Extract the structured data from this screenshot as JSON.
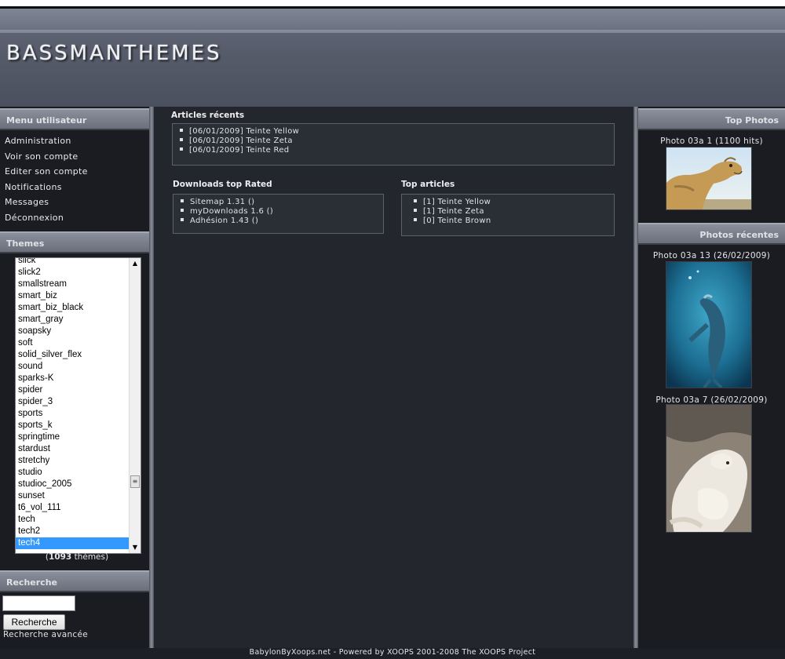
{
  "site": {
    "logo_text": "BASSMANTHEMES"
  },
  "left": {
    "user_menu_title": "Menu utilisateur",
    "user_menu": [
      "Administration",
      "Voir son compte",
      "Editer son compte",
      "Notifications",
      "Messages",
      "Déconnexion"
    ],
    "themes_title": "Themes",
    "themes": [
      "slick",
      "slick2",
      "smallstream",
      "smart_biz",
      "smart_biz_black",
      "smart_gray",
      "soapsky",
      "soft",
      "solid_silver_flex",
      "sound",
      "sparks-K",
      "spider",
      "spider_3",
      "sports",
      "sports_k",
      "springtime",
      "stardust",
      "stretchy",
      "studio",
      "studioc_2005",
      "sunset",
      "t6_vol_111",
      "tech",
      "tech2",
      "tech4"
    ],
    "selected_theme": "tech4",
    "themes_count_number": "1093",
    "themes_count_suffix": "thèmes",
    "search_title": "Recherche",
    "search_value": "",
    "search_button": "Recherche",
    "advanced_search": "Recherche avancée"
  },
  "center": {
    "recent_articles_title": "Articles récents",
    "recent_articles": [
      "[06/01/2009] Teinte Yellow",
      "[06/01/2009] Teinte Zeta",
      "[06/01/2009] Teinte Red"
    ],
    "downloads_title": "Downloads top Rated",
    "downloads": [
      "Sitemap 1.31 ()",
      "myDownloads 1.6 ()",
      "Adhésion 1.43 ()"
    ],
    "top_articles_title": "Top articles",
    "top_articles": [
      "[1] Teinte Yellow",
      "[1] Teinte Zeta",
      "[0] Teinte Brown"
    ]
  },
  "right": {
    "top_photos_title": "Top Photos",
    "top_photo_caption": "Photo 03a 1 (1100 hits)",
    "recent_photos_title": "Photos récentes",
    "recent_photo_1_caption": "Photo 03a 13 (26/02/2009)",
    "recent_photo_2_caption": "Photo 03a 7 (26/02/2009)"
  },
  "footer": {
    "text": "BabylonByXoops.net - Powered by XOOPS 2001-2008 The XOOPS Project"
  },
  "colors": {
    "background": "#23262c",
    "sidebar": "#1a1c21",
    "block_title": "#7a7f8b",
    "selection": "#3399ff"
  }
}
